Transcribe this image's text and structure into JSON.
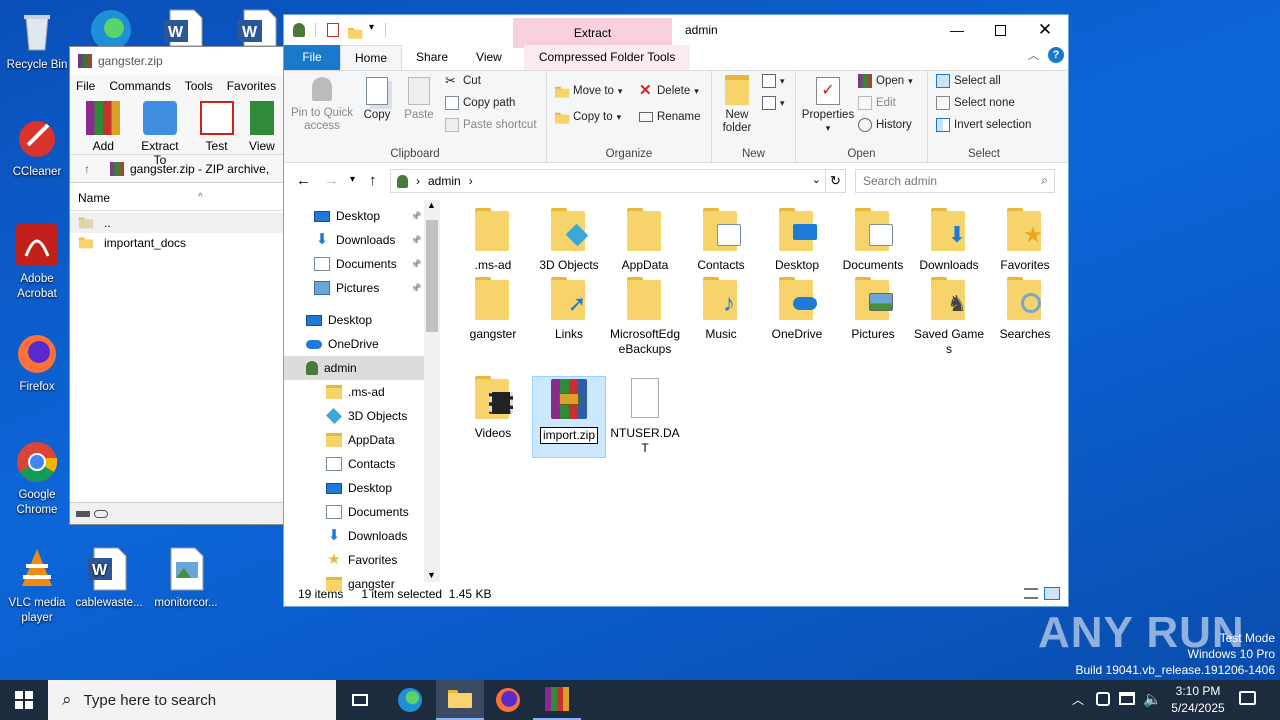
{
  "desktop": {
    "icons": [
      {
        "label": "Recycle Bin"
      },
      {
        "label": "CCleaner"
      },
      {
        "label": "Adobe Acrobat"
      },
      {
        "label": "Firefox"
      },
      {
        "label": "Google Chrome"
      },
      {
        "label": "VLC media player"
      },
      {
        "label": "cablewaste..."
      },
      {
        "label": "monitorcor..."
      }
    ]
  },
  "winrar": {
    "title": "gangster.zip",
    "menu": [
      "File",
      "Commands",
      "Tools",
      "Favorites"
    ],
    "tools": [
      "Add",
      "Extract To",
      "Test",
      "View"
    ],
    "address": "gangster.zip - ZIP archive,",
    "column": "Name",
    "rows": [
      "..",
      "important_docs"
    ]
  },
  "explorer": {
    "title": "admin",
    "context_tab": "Extract",
    "context_sub": "Compressed Folder Tools",
    "tabs": [
      "File",
      "Home",
      "Share",
      "View"
    ],
    "clipboard": {
      "pin": "Pin to Quick access",
      "copy": "Copy",
      "paste": "Paste",
      "cut": "Cut",
      "copy_path": "Copy path",
      "paste_shortcut": "Paste shortcut",
      "label": "Clipboard"
    },
    "organize": {
      "move_to": "Move to",
      "copy_to": "Copy to",
      "delete": "Delete",
      "rename": "Rename",
      "label": "Organize"
    },
    "new": {
      "new_folder": "New folder",
      "label": "New"
    },
    "open": {
      "properties": "Properties",
      "open": "Open",
      "edit": "Edit",
      "history": "History",
      "label": "Open"
    },
    "select": {
      "select_all": "Select all",
      "select_none": "Select none",
      "invert": "Invert selection",
      "label": "Select"
    },
    "breadcrumb": "admin",
    "search_placeholder": "Search admin",
    "nav": [
      {
        "label": "Desktop",
        "icon": "desktop-icon",
        "pinned": true
      },
      {
        "label": "Downloads",
        "icon": "download-icon",
        "pinned": true
      },
      {
        "label": "Documents",
        "icon": "document-icon",
        "pinned": true
      },
      {
        "label": "Pictures",
        "icon": "picture-icon",
        "pinned": true
      },
      {
        "label": "Desktop",
        "icon": "desktop-icon"
      },
      {
        "label": "OneDrive",
        "icon": "cloud-icon"
      },
      {
        "label": "admin",
        "icon": "user-icon",
        "selected": true
      },
      {
        "label": ".ms-ad",
        "icon": "folder-icon"
      },
      {
        "label": "3D Objects",
        "icon": "cube-icon"
      },
      {
        "label": "AppData",
        "icon": "folder-icon"
      },
      {
        "label": "Contacts",
        "icon": "contacts-icon"
      },
      {
        "label": "Desktop",
        "icon": "desktop-icon"
      },
      {
        "label": "Documents",
        "icon": "document-icon"
      },
      {
        "label": "Downloads",
        "icon": "download-icon"
      },
      {
        "label": "Favorites",
        "icon": "star-icon"
      },
      {
        "label": "gangster",
        "icon": "folder-icon"
      }
    ],
    "items": [
      {
        "label": ".ms-ad",
        "icon": "folder-icon"
      },
      {
        "label": "3D Objects",
        "icon": "cube-folder-icon"
      },
      {
        "label": "AppData",
        "icon": "folder-icon"
      },
      {
        "label": "Contacts",
        "icon": "contacts-folder-icon"
      },
      {
        "label": "Desktop",
        "icon": "desktop-folder-icon"
      },
      {
        "label": "Documents",
        "icon": "documents-folder-icon"
      },
      {
        "label": "Downloads",
        "icon": "downloads-folder-icon"
      },
      {
        "label": "Favorites",
        "icon": "favorites-folder-icon"
      },
      {
        "label": "gangster",
        "icon": "folder-icon"
      },
      {
        "label": "Links",
        "icon": "links-folder-icon"
      },
      {
        "label": "MicrosoftEdgeBackups",
        "icon": "folder-icon"
      },
      {
        "label": "Music",
        "icon": "music-folder-icon"
      },
      {
        "label": "OneDrive",
        "icon": "onedrive-folder-icon"
      },
      {
        "label": "Pictures",
        "icon": "pictures-folder-icon"
      },
      {
        "label": "Saved Games",
        "icon": "saved-games-folder-icon"
      },
      {
        "label": "Searches",
        "icon": "searches-folder-icon"
      },
      {
        "label": "Videos",
        "icon": "videos-folder-icon"
      },
      {
        "label": "import.zip",
        "icon": "winrar-archive-icon",
        "selected": true
      },
      {
        "label": "NTUSER.DAT",
        "icon": "file-icon"
      }
    ],
    "status": {
      "count": "19 items",
      "selected": "1 item selected",
      "size": "1.45 KB"
    }
  },
  "taskbar": {
    "search_placeholder": "Type here to search",
    "time": "3:10 PM",
    "date": "5/24/2025"
  },
  "watermark": {
    "brand": "ANY RUN",
    "mode": "Test Mode",
    "os": "Windows 10 Pro",
    "build": "Build 19041.vb_release.191206-1406"
  }
}
